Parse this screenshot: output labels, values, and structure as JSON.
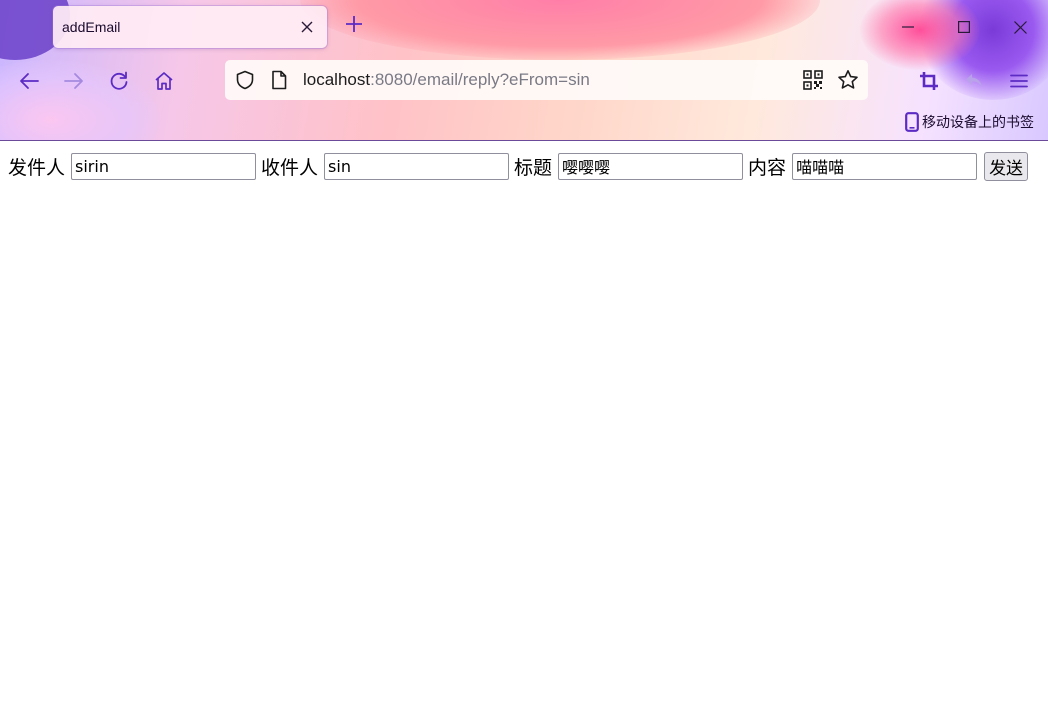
{
  "browser": {
    "tab": {
      "title": "addEmail"
    },
    "url": {
      "host": "localhost",
      "rest": ":8080/email/reply?eFrom=sin"
    },
    "bookmarks": {
      "mobile_label": "移动设备上的书签"
    },
    "accent_color": "#5b2bc4"
  },
  "form": {
    "sender_label": "发件人",
    "sender_value": "sirin",
    "recipient_label": "收件人",
    "recipient_value": "sin",
    "subject_label": "标题",
    "subject_value": "嘤嘤嘤",
    "content_label": "内容",
    "content_value": "喵喵喵",
    "submit_label": "发送"
  }
}
